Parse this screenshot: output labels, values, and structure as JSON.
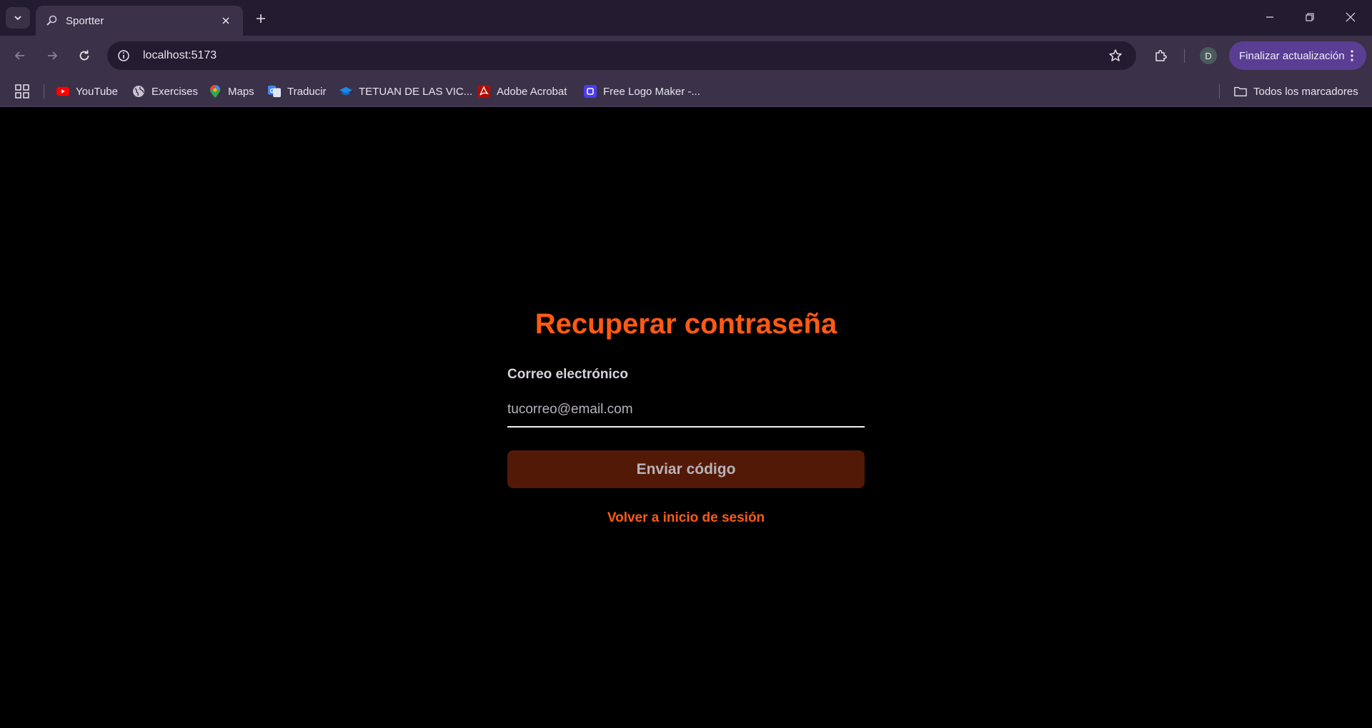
{
  "browser": {
    "tab": {
      "title": "Sportter"
    },
    "address": {
      "url": "localhost:5173"
    },
    "profile_initial": "D",
    "update_button": "Finalizar actualización",
    "bookmarks": [
      {
        "label": "YouTube",
        "icon": "youtube-icon"
      },
      {
        "label": "Exercises",
        "icon": "globe-icon"
      },
      {
        "label": "Maps",
        "icon": "maps-pin-icon"
      },
      {
        "label": "Traducir",
        "icon": "translate-icon"
      },
      {
        "label": "TETUAN DE LAS VIC...",
        "icon": "graduation-cap-icon"
      },
      {
        "label": "Adobe Acrobat",
        "icon": "acrobat-icon"
      },
      {
        "label": "Free Logo Maker -...",
        "icon": "logo-maker-icon"
      }
    ],
    "all_bookmarks": "Todos los marcadores"
  },
  "page": {
    "title": "Recuperar contraseña",
    "email_label": "Correo electrónico",
    "email_placeholder": "tucorreo@email.com",
    "submit_label": "Enviar código",
    "back_link": "Volver a inicio de sesión"
  },
  "colors": {
    "accent": "#ff5a14",
    "button_bg": "#521a06",
    "chrome_bg": "#3b3148",
    "tabbar_bg": "#231c31",
    "update_btn": "#5a3e93"
  }
}
